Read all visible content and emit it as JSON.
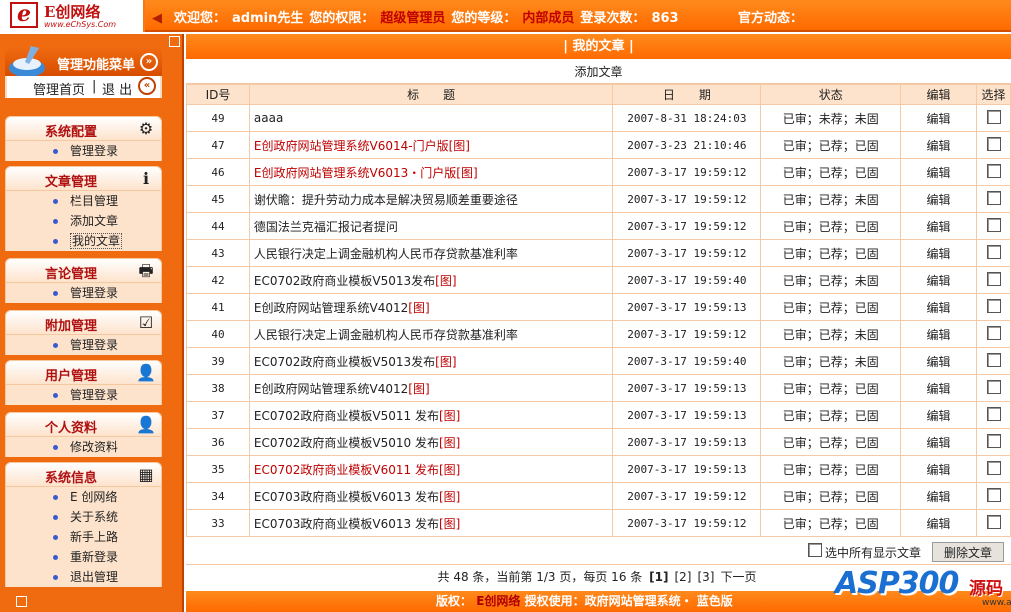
{
  "header": {
    "logo_name": "E创网络",
    "logo_url": "www.eChSys.Com",
    "welcome_label": "欢迎您：",
    "user": "admin先生",
    "perm_label": "您的权限：",
    "perm_value": "超级管理员",
    "level_label": "您的等级：",
    "level_value": "内部成员",
    "login_label": "登录次数：",
    "login_count": "863",
    "news_label": "官方动态："
  },
  "sidebar": {
    "menu_title": "管理功能菜单",
    "home_link": "管理首页",
    "logout_link": "退 出",
    "groups": [
      {
        "title": "系统配置",
        "items": [
          "管理登录"
        ]
      },
      {
        "title": "文章管理",
        "items": [
          "栏目管理",
          "添加文章",
          "我的文章"
        ]
      },
      {
        "title": "言论管理",
        "items": [
          "管理登录"
        ]
      },
      {
        "title": "附加管理",
        "items": [
          "管理登录"
        ]
      },
      {
        "title": "用户管理",
        "items": [
          "管理登录"
        ]
      },
      {
        "title": "个人资料",
        "items": [
          "修改资料"
        ]
      },
      {
        "title": "系统信息",
        "items": [
          "E 创网络",
          "关于系统",
          "新手上路",
          "重新登录",
          "退出管理"
        ]
      }
    ]
  },
  "main": {
    "title": "| 我的文章 |",
    "add_link": "添加文章",
    "columns": [
      "ID号",
      "标　　题",
      "日　　期",
      "状态",
      "编辑",
      "选择"
    ],
    "rows": [
      {
        "id": "49",
        "title": "aaaa",
        "tag": "",
        "date": "2007-8-31 18:24:03",
        "status": "已审；未荐；未固",
        "edit": "编辑",
        "red": false
      },
      {
        "id": "47",
        "title": "E创政府网站管理系统V6014-门户版",
        "tag": "[图]",
        "date": "2007-3-23 21:10:46",
        "status": "已审；已荐；已固",
        "edit": "编辑",
        "red": true
      },
      {
        "id": "46",
        "title": "E创政府网站管理系统V6013・门户版",
        "tag": "[图]",
        "date": "2007-3-17 19:59:12",
        "status": "已审；已荐；已固",
        "edit": "编辑",
        "red": true
      },
      {
        "id": "45",
        "title": "谢伏瞻：提升劳动力成本是解决贸易顺差重要途径",
        "tag": "",
        "date": "2007-3-17 19:59:12",
        "status": "已审；已荐；未固",
        "edit": "编辑",
        "red": false
      },
      {
        "id": "44",
        "title": "德国法兰克福汇报记者提问",
        "tag": "",
        "date": "2007-3-17 19:59:12",
        "status": "已审；已荐；已固",
        "edit": "编辑",
        "red": false
      },
      {
        "id": "43",
        "title": "人民银行决定上调金融机构人民币存贷款基准利率",
        "tag": "",
        "date": "2007-3-17 19:59:12",
        "status": "已审；已荐；已固",
        "edit": "编辑",
        "red": false
      },
      {
        "id": "42",
        "title": "EC0702政府商业模板V5013发布",
        "tag": "[图]",
        "date": "2007-3-17 19:59:40",
        "status": "已审；已荐；未固",
        "edit": "编辑",
        "red": false
      },
      {
        "id": "41",
        "title": "E创政府网站管理系统V4012",
        "tag": "[图]",
        "date": "2007-3-17 19:59:13",
        "status": "已审；已荐；已固",
        "edit": "编辑",
        "red": false
      },
      {
        "id": "40",
        "title": "人民银行决定上调金融机构人民币存贷款基准利率",
        "tag": "",
        "date": "2007-3-17 19:59:12",
        "status": "已审；已荐；未固",
        "edit": "编辑",
        "red": false
      },
      {
        "id": "39",
        "title": "EC0702政府商业模板V5013发布",
        "tag": "[图]",
        "date": "2007-3-17 19:59:40",
        "status": "已审；已荐；未固",
        "edit": "编辑",
        "red": false
      },
      {
        "id": "38",
        "title": "E创政府网站管理系统V4012",
        "tag": "[图]",
        "date": "2007-3-17 19:59:13",
        "status": "已审；已荐；已固",
        "edit": "编辑",
        "red": false
      },
      {
        "id": "37",
        "title": "EC0702政府商业模板V5011 发布",
        "tag": "[图]",
        "date": "2007-3-17 19:59:13",
        "status": "已审；已荐；已固",
        "edit": "编辑",
        "red": false
      },
      {
        "id": "36",
        "title": "EC0702政府商业模板V5010 发布",
        "tag": "[图]",
        "date": "2007-3-17 19:59:13",
        "status": "已审；已荐；已固",
        "edit": "编辑",
        "red": false
      },
      {
        "id": "35",
        "title": "EC0702政府商业模板V6011 发布",
        "tag": "[图]",
        "date": "2007-3-17 19:59:13",
        "status": "已审；已荐；已固",
        "edit": "编辑",
        "red": true
      },
      {
        "id": "34",
        "title": "EC0703政府商业模板V6013 发布",
        "tag": "[图]",
        "date": "2007-3-17 19:59:12",
        "status": "已审；已荐；已固",
        "edit": "编辑",
        "red": false
      },
      {
        "id": "33",
        "title": "EC0703政府商业模板V6013 发布",
        "tag": "[图]",
        "date": "2007-3-17 19:59:12",
        "status": "已审；已荐；已固",
        "edit": "编辑",
        "red": false
      }
    ],
    "select_all_label": "选中所有显示文章",
    "delete_button": "删除文章",
    "pager": {
      "summary": "共 48 条，当前第 1/3 页，每页 16 条",
      "pages": [
        "[1]",
        "[2]",
        "[3]"
      ],
      "next": "下一页"
    }
  },
  "footer": {
    "label": "版权：",
    "company": "E创网络",
    "license": "授权使用：政府网站管理系统・ 蓝色版"
  },
  "watermark": {
    "brand": "ASP300",
    "cn": "源码",
    "url": "www.asp300.com"
  },
  "colors": {
    "accent": "#ff6a00",
    "link_red": "#c00000",
    "pale": "#fde3cc"
  }
}
